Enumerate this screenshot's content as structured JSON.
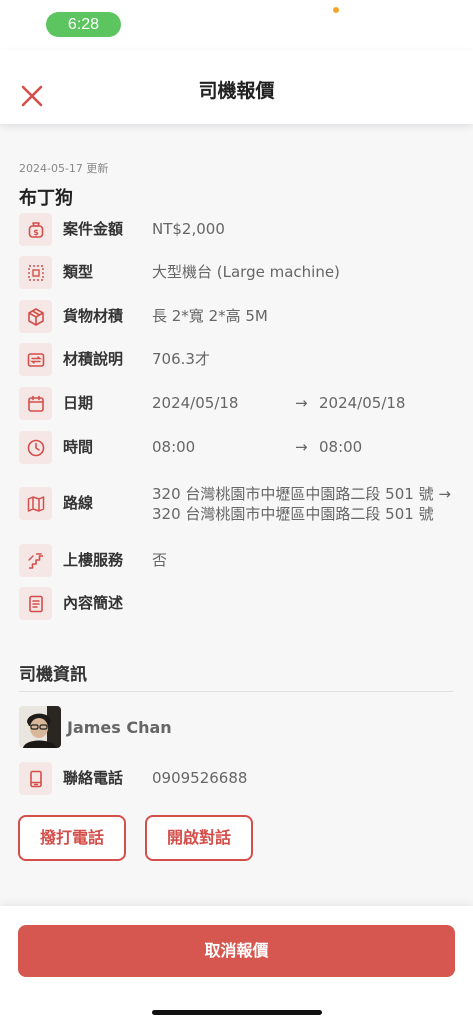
{
  "status_bar": {
    "time": "6:28"
  },
  "header": {
    "title": "司機報價"
  },
  "quote": {
    "updated": "2024-05-17 更新",
    "customer": "布丁狗",
    "rows": [
      {
        "icon": "money-bag-icon",
        "label": "案件金額",
        "value": "NT$2,000"
      },
      {
        "icon": "large-machine-icon",
        "label": "類型",
        "value": "大型機台 (Large machine)"
      },
      {
        "icon": "package-icon",
        "label": "貨物材積",
        "value": "長 2*寬 2*高 5M"
      },
      {
        "icon": "transfer-icon",
        "label": "材積說明",
        "value": "706.3才"
      },
      {
        "icon": "calendar-icon",
        "label": "日期",
        "value": "2024/05/18",
        "arrow": "→",
        "value2": "2024/05/18"
      },
      {
        "icon": "clock-icon",
        "label": "時間",
        "value": "08:00",
        "arrow": "→",
        "value2": "08:00"
      },
      {
        "icon": "map-icon",
        "label": "路線",
        "value": "320 台灣桃園市中壢區中園路二段 501 號 → 320 台灣桃園市中壢區中園路二段 501 號"
      },
      {
        "icon": "stairs-icon",
        "label": "上樓服務",
        "value": "否"
      },
      {
        "icon": "document-icon",
        "label": "內容簡述",
        "value": ""
      }
    ]
  },
  "driver": {
    "section_title": "司機資訊",
    "name": "James Chan",
    "phone_label": "聯絡電話",
    "phone": "0909526688",
    "call_button": "撥打電話",
    "chat_button": "開啟對話"
  },
  "footer": {
    "cancel_button": "取消報價"
  },
  "colors": {
    "accent": "#d6574f",
    "icon_bg": "#f4e7e6",
    "status_green": "#5cc560"
  }
}
